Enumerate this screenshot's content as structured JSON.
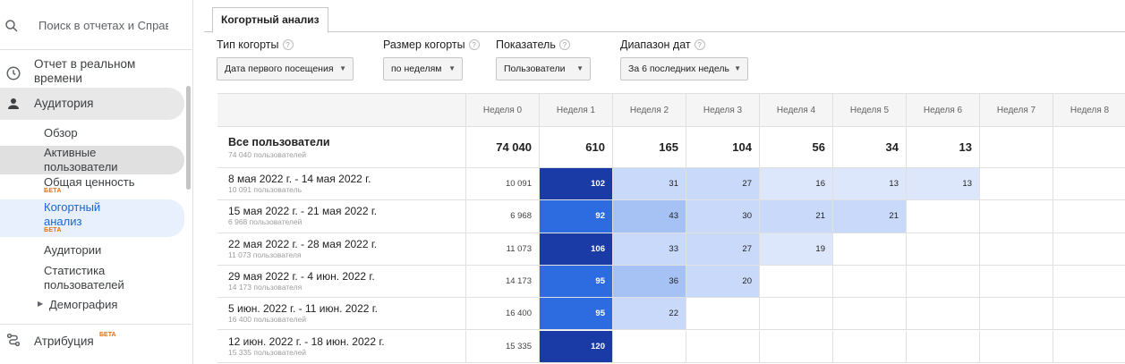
{
  "sidebar": {
    "search_placeholder": "Поиск в отчетах и Справке",
    "realtime_label": "Отчет в реальном времени",
    "audience_label": "Аудитория",
    "items": [
      {
        "label": "Обзор"
      },
      {
        "label": "Активные пользователи"
      },
      {
        "label": "Общая ценность",
        "badge": "БЕТА"
      },
      {
        "label": "Когортный анализ",
        "badge": "БЕТА"
      },
      {
        "label": "Аудитории"
      },
      {
        "label": "Статистика пользователей"
      },
      {
        "label": "Демография"
      }
    ],
    "attribution_label": "Атрибуция",
    "attribution_badge": "БЕТА"
  },
  "tab": {
    "label": "Когортный анализ"
  },
  "controls": {
    "cohort_type": {
      "label": "Тип когорты",
      "value": "Дата первого посещения"
    },
    "cohort_size": {
      "label": "Размер когорты",
      "value": "по неделям"
    },
    "metric": {
      "label": "Показатель",
      "value": "Пользователи"
    },
    "date_range": {
      "label": "Диапазон дат",
      "value": "За 6 последних недель"
    }
  },
  "table": {
    "columns": [
      "Неделя 0",
      "Неделя 1",
      "Неделя 2",
      "Неделя 3",
      "Неделя 4",
      "Неделя 5",
      "Неделя 6",
      "Неделя 7",
      "Неделя 8"
    ],
    "total": {
      "label": "Все пользователи",
      "sub": "74 040 пользователей",
      "values": [
        "74 040",
        "610",
        "165",
        "104",
        "56",
        "34",
        "13",
        "",
        ""
      ]
    },
    "rows": [
      {
        "label": "8 мая 2022 г. - 14 мая 2022 г.",
        "sub": "10 091 пользователь",
        "values": [
          "10 091",
          "102",
          "31",
          "27",
          "16",
          "13",
          "13",
          "",
          ""
        ]
      },
      {
        "label": "15 мая 2022 г. - 21 мая 2022 г.",
        "sub": "6 968 пользователей",
        "values": [
          "6 968",
          "92",
          "43",
          "30",
          "21",
          "21",
          "",
          "",
          ""
        ]
      },
      {
        "label": "22 мая 2022 г. - 28 мая 2022 г.",
        "sub": "11 073 пользователя",
        "values": [
          "11 073",
          "106",
          "33",
          "27",
          "19",
          "",
          "",
          "",
          ""
        ]
      },
      {
        "label": "29 мая 2022 г. - 4 июн. 2022 г.",
        "sub": "14 173 пользователя",
        "values": [
          "14 173",
          "95",
          "36",
          "20",
          "",
          "",
          "",
          "",
          ""
        ]
      },
      {
        "label": "5 июн. 2022 г. - 11 июн. 2022 г.",
        "sub": "16 400 пользователей",
        "values": [
          "16 400",
          "95",
          "22",
          "",
          "",
          "",
          "",
          "",
          ""
        ]
      },
      {
        "label": "12 июн. 2022 г. - 18 июн. 2022 г.",
        "sub": "15 335 пользователей",
        "values": [
          "15 335",
          "120",
          "",
          "",
          "",
          "",
          "",
          "",
          ""
        ]
      }
    ],
    "heat_colors": {
      "darkest": "#1a3aa6",
      "dark": "#2d6be0",
      "medium": "#a6c1f4",
      "light": "#c8d9fa",
      "lightest": "#dce7fc"
    }
  }
}
